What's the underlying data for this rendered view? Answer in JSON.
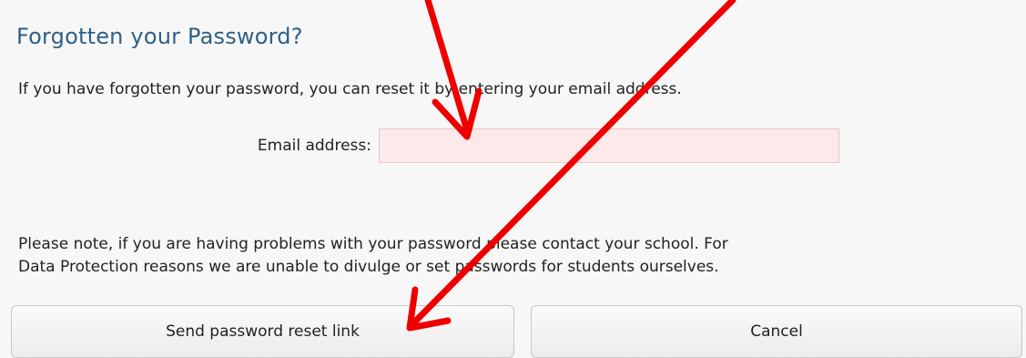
{
  "form": {
    "title": "Forgotten your Password?",
    "intro": "If you have forgotten your password, you can reset it by entering your email address.",
    "email_label": "Email address:",
    "email_value": "",
    "email_placeholder": "",
    "note_line1": "Please note, if you are having problems with your password please contact your school. For",
    "note_line2": "Data Protection reasons we are unable to divulge or set passwords for students ourselves.",
    "send_label": "Send password reset link",
    "cancel_label": "Cancel"
  },
  "colors": {
    "title": "#2f5f85",
    "input_bg": "#fde9e9",
    "annotation_arrow": "#ee0000"
  }
}
